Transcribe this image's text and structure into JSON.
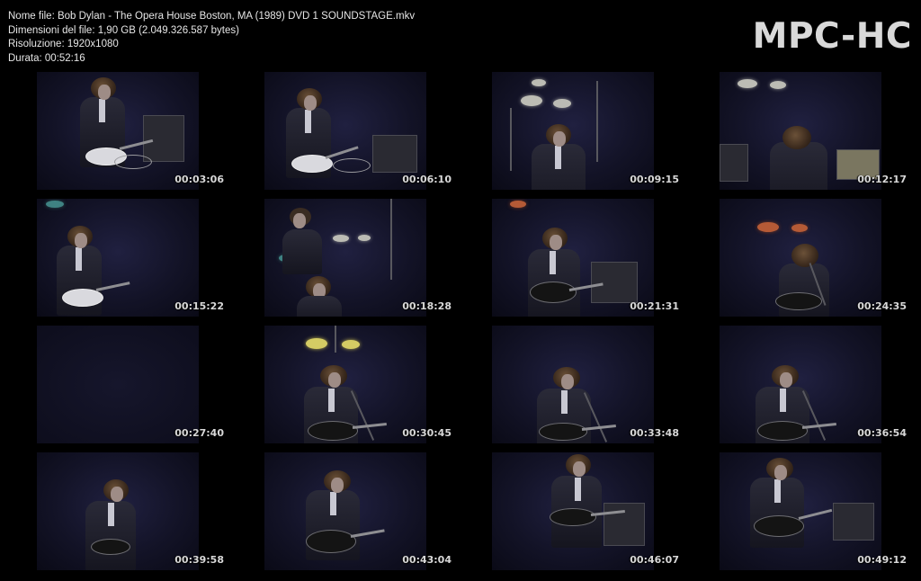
{
  "header": {
    "line1": "Nome file: Bob Dylan - The Opera House Boston, MA (1989) DVD 1 SOUNDSTAGE.mkv",
    "line2": "Dimensioni del file: 1,90 GB (2.049.326.587 bytes)",
    "line3": "Risoluzione: 1920x1080",
    "line4": "Durata: 00:52:16"
  },
  "logo": "MPC-HC",
  "thumbnails": [
    {
      "time": "00:03:06"
    },
    {
      "time": "00:06:10"
    },
    {
      "time": "00:09:15"
    },
    {
      "time": "00:12:17"
    },
    {
      "time": "00:15:22"
    },
    {
      "time": "00:18:28"
    },
    {
      "time": "00:21:31"
    },
    {
      "time": "00:24:35"
    },
    {
      "time": "00:27:40"
    },
    {
      "time": "00:30:45"
    },
    {
      "time": "00:33:48"
    },
    {
      "time": "00:36:54"
    },
    {
      "time": "00:39:58"
    },
    {
      "time": "00:43:04"
    },
    {
      "time": "00:46:07"
    },
    {
      "time": "00:49:12"
    }
  ],
  "colors": {
    "background": "#000000",
    "header_text": "#e6e6e6",
    "logo_text": "#d9d9d9",
    "frame_base": "#131327"
  }
}
